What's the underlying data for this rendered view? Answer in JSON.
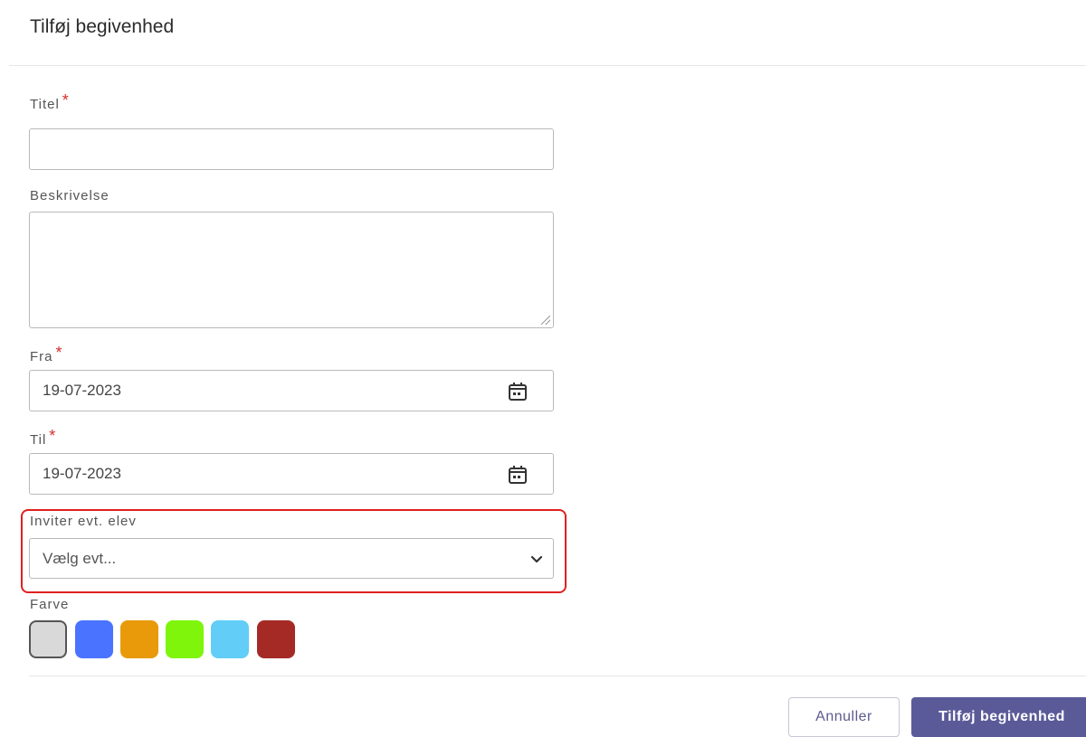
{
  "dialog": {
    "title": "Tilføj begivenhed"
  },
  "form": {
    "title_field": {
      "label": "Titel",
      "required_mark": "*",
      "value": ""
    },
    "description_field": {
      "label": "Beskrivelse",
      "value": ""
    },
    "from_field": {
      "label": "Fra",
      "required_mark": "*",
      "value": "19-07-2023",
      "icon": "calendar-icon"
    },
    "to_field": {
      "label": "Til",
      "required_mark": "*",
      "value": "19-07-2023",
      "icon": "calendar-icon"
    },
    "invite_field": {
      "label": "Inviter evt. elev",
      "selected": "Vælg evt...",
      "icon": "chevron-down-icon"
    },
    "color_field": {
      "label": "Farve",
      "colors": [
        "#d9d9d9",
        "#4a73ff",
        "#e89a0a",
        "#7ef50a",
        "#62cdf7",
        "#a52a25"
      ],
      "selected_index": 0
    }
  },
  "footer": {
    "cancel_label": "Annuller",
    "submit_label": "Tilføj begivenhed"
  },
  "theme": {
    "accent": "#5b5a99",
    "required": "#d32f2f",
    "highlight": "#e02020"
  }
}
